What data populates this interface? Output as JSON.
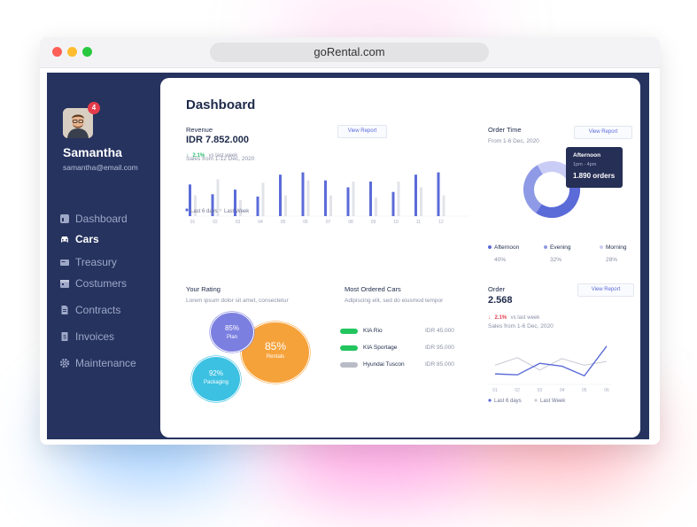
{
  "browser": {
    "url": "goRental.com"
  },
  "user": {
    "name": "Samantha",
    "email": "samantha@email.com",
    "notification_count": "4"
  },
  "sidebar": {
    "items": [
      {
        "label": "Dashboard",
        "icon": "dashboard-icon",
        "active": false
      },
      {
        "label": "Cars",
        "icon": "car-icon",
        "active": true
      },
      {
        "label": "Treasury",
        "icon": "wallet-icon",
        "active": false
      },
      {
        "label": "Costumers",
        "icon": "calendar-icon",
        "active": false
      },
      {
        "label": "Contracts",
        "icon": "document-icon",
        "active": false
      },
      {
        "label": "Invoices",
        "icon": "invoice-icon",
        "active": false
      },
      {
        "label": "Maintenance",
        "icon": "gear-icon",
        "active": false
      }
    ]
  },
  "dashboard": {
    "title": "Dashboard"
  },
  "revenue": {
    "label": "Revenue",
    "value": "IDR 7.852.000",
    "change": "2.1%",
    "change_suffix": "vs last week",
    "subtitle": "Sales from 1-12 Dec, 2020",
    "button": "View Report",
    "legend": [
      "Last 6 days",
      "Last Week"
    ],
    "colors": {
      "current": "#5b6bd8",
      "previous": "#e3e4ea"
    }
  },
  "order_time": {
    "label": "Order Time",
    "subtitle": "From 1-6 Dec, 2020",
    "button": "View Report",
    "tooltip": {
      "title": "Afternoon",
      "time": "1pm - 4pm",
      "value": "1.890 orders"
    },
    "segments": [
      {
        "name": "Afternoon",
        "value": "40%",
        "color": "#5b6bd8"
      },
      {
        "name": "Evening",
        "value": "32%",
        "color": "#8f9ae6"
      },
      {
        "name": "Morning",
        "value": "28%",
        "color": "#c9cdf5"
      }
    ]
  },
  "rating": {
    "label": "Your Rating",
    "subtitle": "Lorem ipsum dolor sit amet, consectetur",
    "bubbles": [
      {
        "value": "85%",
        "name": "Plan",
        "color": "#7b7fe0"
      },
      {
        "value": "85%",
        "name": "Rentals",
        "color": "#f6a23a"
      },
      {
        "value": "92%",
        "name": "Packaging",
        "color": "#3cc1e2"
      }
    ]
  },
  "most_ordered": {
    "label": "Most Ordered Cars",
    "subtitle": "Adipiscing elit, sed do eiusmod tempor",
    "cars": [
      {
        "name": "KIA Rio",
        "price": "IDR 45.000",
        "color": "#22c55e"
      },
      {
        "name": "KIA Sportage",
        "price": "IDR 95.000",
        "color": "#22c55e"
      },
      {
        "name": "Hyundai Tuscon",
        "price": "IDR 85.000",
        "color": "#b9bcc6"
      }
    ]
  },
  "order": {
    "label": "Order",
    "value": "2.568",
    "change": "2.1%",
    "change_suffix": "vs last week",
    "subtitle": "Sales from 1-6 Dec, 2020",
    "button": "View Report",
    "legend": [
      "Last 6 days",
      "Last Week"
    ],
    "colors": {
      "current": "#5b6bd8",
      "previous": "#c9cad3"
    }
  },
  "chart_data": [
    {
      "type": "bar",
      "categories": [
        "01",
        "02",
        "03",
        "04",
        "05",
        "06",
        "07",
        "08",
        "09",
        "10",
        "11",
        "12"
      ],
      "series": [
        {
          "name": "Last 6 days",
          "values": [
            55,
            38,
            46,
            34,
            72,
            76,
            62,
            50,
            60,
            42,
            72,
            76
          ]
        },
        {
          "name": "Last Week",
          "values": [
            36,
            64,
            28,
            58,
            36,
            62,
            36,
            60,
            32,
            60,
            50,
            36
          ]
        }
      ],
      "xlabel": "",
      "ylabel": "",
      "ylim": [
        0,
        80
      ]
    },
    {
      "type": "pie",
      "categories": [
        "Afternoon",
        "Evening",
        "Morning"
      ],
      "values": [
        40,
        32,
        28
      ]
    },
    {
      "type": "line",
      "categories": [
        "01",
        "02",
        "03",
        "04",
        "05",
        "06"
      ],
      "series": [
        {
          "name": "Last 6 days",
          "values": [
            22,
            20,
            44,
            38,
            18,
            80
          ]
        },
        {
          "name": "Last Week",
          "values": [
            40,
            56,
            30,
            54,
            40,
            48
          ]
        }
      ],
      "ylim": [
        0,
        100
      ]
    }
  ]
}
